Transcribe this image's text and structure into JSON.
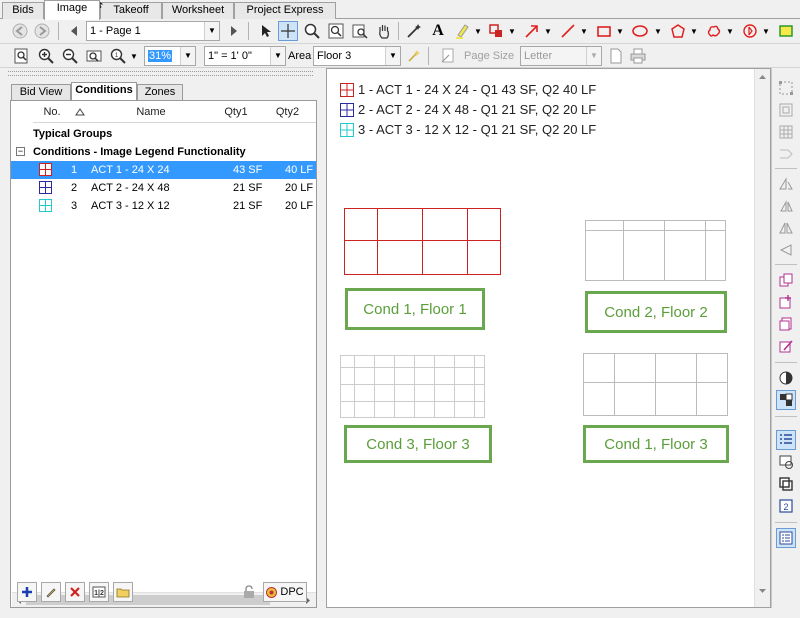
{
  "tabs": [
    "Bids",
    "Image",
    "Takeoff",
    "Worksheet",
    "Project Express"
  ],
  "toolbar1": {
    "page_select": "1 - Page 1",
    "tools": [
      "back-icon",
      "forward-icon",
      "prev-page-icon",
      "next-page-icon",
      "select-arrow-icon",
      "crosshair-icon",
      "zoom-window-icon",
      "zoom-fit-icon",
      "find-icon",
      "pan-hand-icon",
      "magic-wand-icon",
      "text-icon",
      "highlighter-icon",
      "stamp-icon",
      "arrow-icon",
      "line-icon",
      "rectangle-icon",
      "ellipse-icon",
      "polygon-icon",
      "cloud-icon",
      "dimension-icon",
      "yellow-rect-icon"
    ]
  },
  "toolbar2": {
    "zoom_value": "31%",
    "scale_value": "1\" = 1' 0\"",
    "area_label": "Area",
    "area_value": "Floor 3",
    "page_size_label": "Page Size",
    "page_size_value": "Letter"
  },
  "panel": {
    "tabs": [
      "Bid View",
      "Conditions",
      "Zones"
    ],
    "active_tab": "Conditions",
    "columns": [
      "No.",
      "Name",
      "Qty1",
      "Qty2"
    ],
    "group_typical": "Typical Groups",
    "group_conditions": "Conditions - Image Legend Functionality",
    "rows": [
      {
        "no": "1",
        "name": "ACT 1 - 24 X 24",
        "qty1": "43 SF",
        "qty2": "40 LF",
        "color": "#cc2222",
        "selected": true
      },
      {
        "no": "2",
        "name": "ACT 2 - 24 X 48",
        "qty1": "21 SF",
        "qty2": "20 LF",
        "color": "#2a2aa0",
        "selected": false
      },
      {
        "no": "3",
        "name": "ACT 3 - 12 X 12",
        "qty1": "21 SF",
        "qty2": "20 LF",
        "color": "#22cccc",
        "selected": false
      }
    ],
    "dpc_label": "DPC"
  },
  "canvas": {
    "legend": [
      {
        "text": "1 - ACT 1 - 24 X 24 - Q1 43 SF, Q2 40 LF",
        "color": "#cc2222"
      },
      {
        "text": "2 - ACT 2 - 24 X 48 - Q1 21 SF, Q2 20 LF",
        "color": "#2a2aa0"
      },
      {
        "text": "3 - ACT 3 - 12 X 12 - Q1 21 SF, Q2 20 LF",
        "color": "#22cccc"
      }
    ],
    "captions": [
      "Cond 1, Floor 1",
      "Cond 2, Floor 2",
      "Cond 3, Floor 3",
      "Cond 1, Floor 3"
    ],
    "colors": {
      "red_grid": "#cc2222",
      "gray_grid": "#bbbbbb",
      "caption_green": "#6aa84f"
    }
  }
}
